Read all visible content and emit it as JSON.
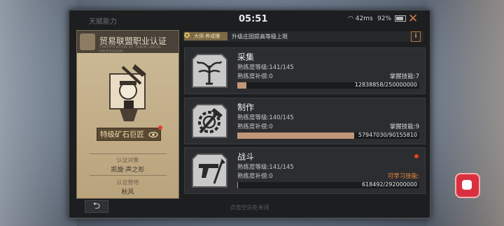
{
  "status_bar": {
    "screen_title": "天赋能力",
    "clock": "05:51",
    "ping": "42ms",
    "battery": "92%"
  },
  "certification_panel": {
    "title": "贸易联盟职业认证",
    "subtitle": "CERTIFICATION OF TRADE UNION PROFESSION",
    "badge_title": "特级矿石巨匠",
    "target_label": "认证对象",
    "target_value": "凯旋·声之形",
    "camp_label": "认证营地",
    "camp_value": "秋风"
  },
  "header": {
    "tag": "大师·养成爆",
    "text": "升级庄园提高等级上限",
    "info_label": "i"
  },
  "professions": [
    {
      "name": "采集",
      "level_label": "熟练度等级:141/145",
      "comp_label": "熟练度补偿:0",
      "skill_label": "掌握技能:7",
      "progress_text": "12838858/250000000",
      "progress": 0.0514
    },
    {
      "name": "制作",
      "level_label": "熟练度等级:140/145",
      "comp_label": "熟练度补偿:0",
      "skill_label": "掌握技能:9",
      "progress_text": "57947030/90155810",
      "progress": 0.6427
    },
    {
      "name": "战斗",
      "level_label": "熟练度等级:141/145",
      "comp_label": "熟练度补偿:0",
      "skill_label": "可学习技能:",
      "progress_text": "618492/292000000",
      "progress": 0.0021
    }
  ],
  "footer": {
    "back_label": "⮌",
    "hint": "点击空白处关闭"
  },
  "colors": {
    "accent": "#c29678",
    "alert": "#e5401f",
    "skill_available": "#ee8a3a"
  }
}
